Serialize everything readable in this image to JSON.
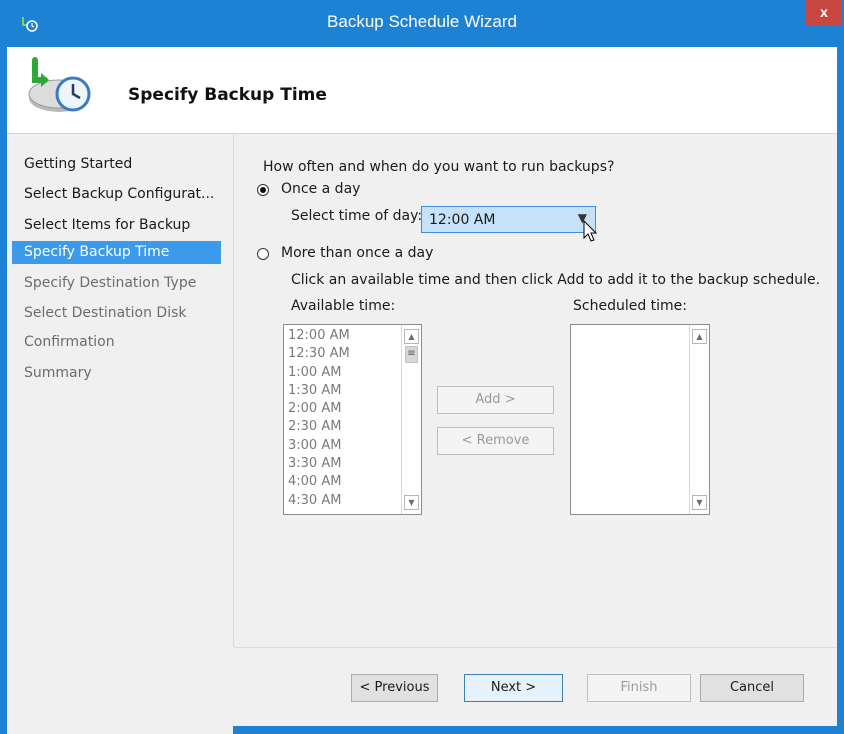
{
  "window": {
    "title": "Backup Schedule Wizard",
    "close_label": "x",
    "accent_color": "#1e82d4"
  },
  "header": {
    "title": "Specify Backup Time"
  },
  "sidebar": {
    "items": [
      {
        "label": "Getting Started",
        "state": "normal"
      },
      {
        "label": "Select Backup Configurat...",
        "state": "normal"
      },
      {
        "label": "Select Items for Backup",
        "state": "normal"
      },
      {
        "label": "Specify Backup Time",
        "state": "active"
      },
      {
        "label": "Specify Destination Type",
        "state": "inactive"
      },
      {
        "label": "Select Destination Disk",
        "state": "inactive"
      },
      {
        "label": "Confirmation",
        "state": "inactive"
      },
      {
        "label": "Summary",
        "state": "inactive"
      }
    ]
  },
  "main": {
    "question": "How often and when do you want to run backups?",
    "once_label": "Once a day",
    "time_of_day_label": "Select time of day:",
    "time_of_day_value": "12:00 AM",
    "more_label": "More than once a day",
    "instructions": "Click an available time and then click Add to add it to the backup schedule.",
    "available_label": "Available time:",
    "scheduled_label": "Scheduled time:",
    "available_times": [
      "12:00 AM",
      "12:30 AM",
      "1:00 AM",
      "1:30 AM",
      "2:00 AM",
      "2:30 AM",
      "3:00 AM",
      "3:30 AM",
      "4:00 AM",
      "4:30 AM"
    ],
    "add_label": "Add >",
    "remove_label": "< Remove"
  },
  "footer": {
    "previous_label": "< Previous",
    "next_label": "Next >",
    "finish_label": "Finish",
    "cancel_label": "Cancel"
  }
}
